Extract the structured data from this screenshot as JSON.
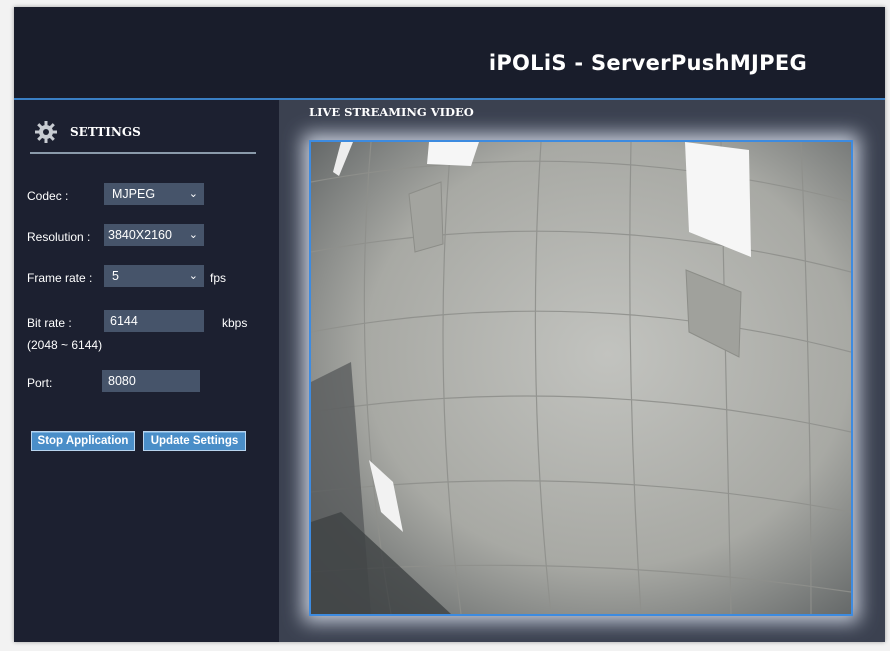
{
  "header": {
    "title": "iPOLiS - ServerPushMJPEG"
  },
  "settings": {
    "title": "SETTINGS",
    "icon": "gear-icon",
    "codec_label": "Codec :",
    "codec_value": "MJPEG",
    "resolution_label": "Resolution :",
    "resolution_value": "3840X2160",
    "framerate_label": "Frame rate :",
    "framerate_value": "5",
    "framerate_unit": "fps",
    "bitrate_label": "Bit rate :",
    "bitrate_value": "6144",
    "bitrate_unit": "kbps",
    "bitrate_range": "(2048 ~ 6144)",
    "port_label": "Port:",
    "port_value": "8080"
  },
  "buttons": {
    "stop": "Stop Application",
    "update": "Update Settings"
  },
  "video": {
    "title": "LIVE STREAMING VIDEO"
  },
  "colors": {
    "background": "#1c2030",
    "accent": "#3a7fc4",
    "button": "#4a8ec8",
    "field": "#46546a"
  }
}
